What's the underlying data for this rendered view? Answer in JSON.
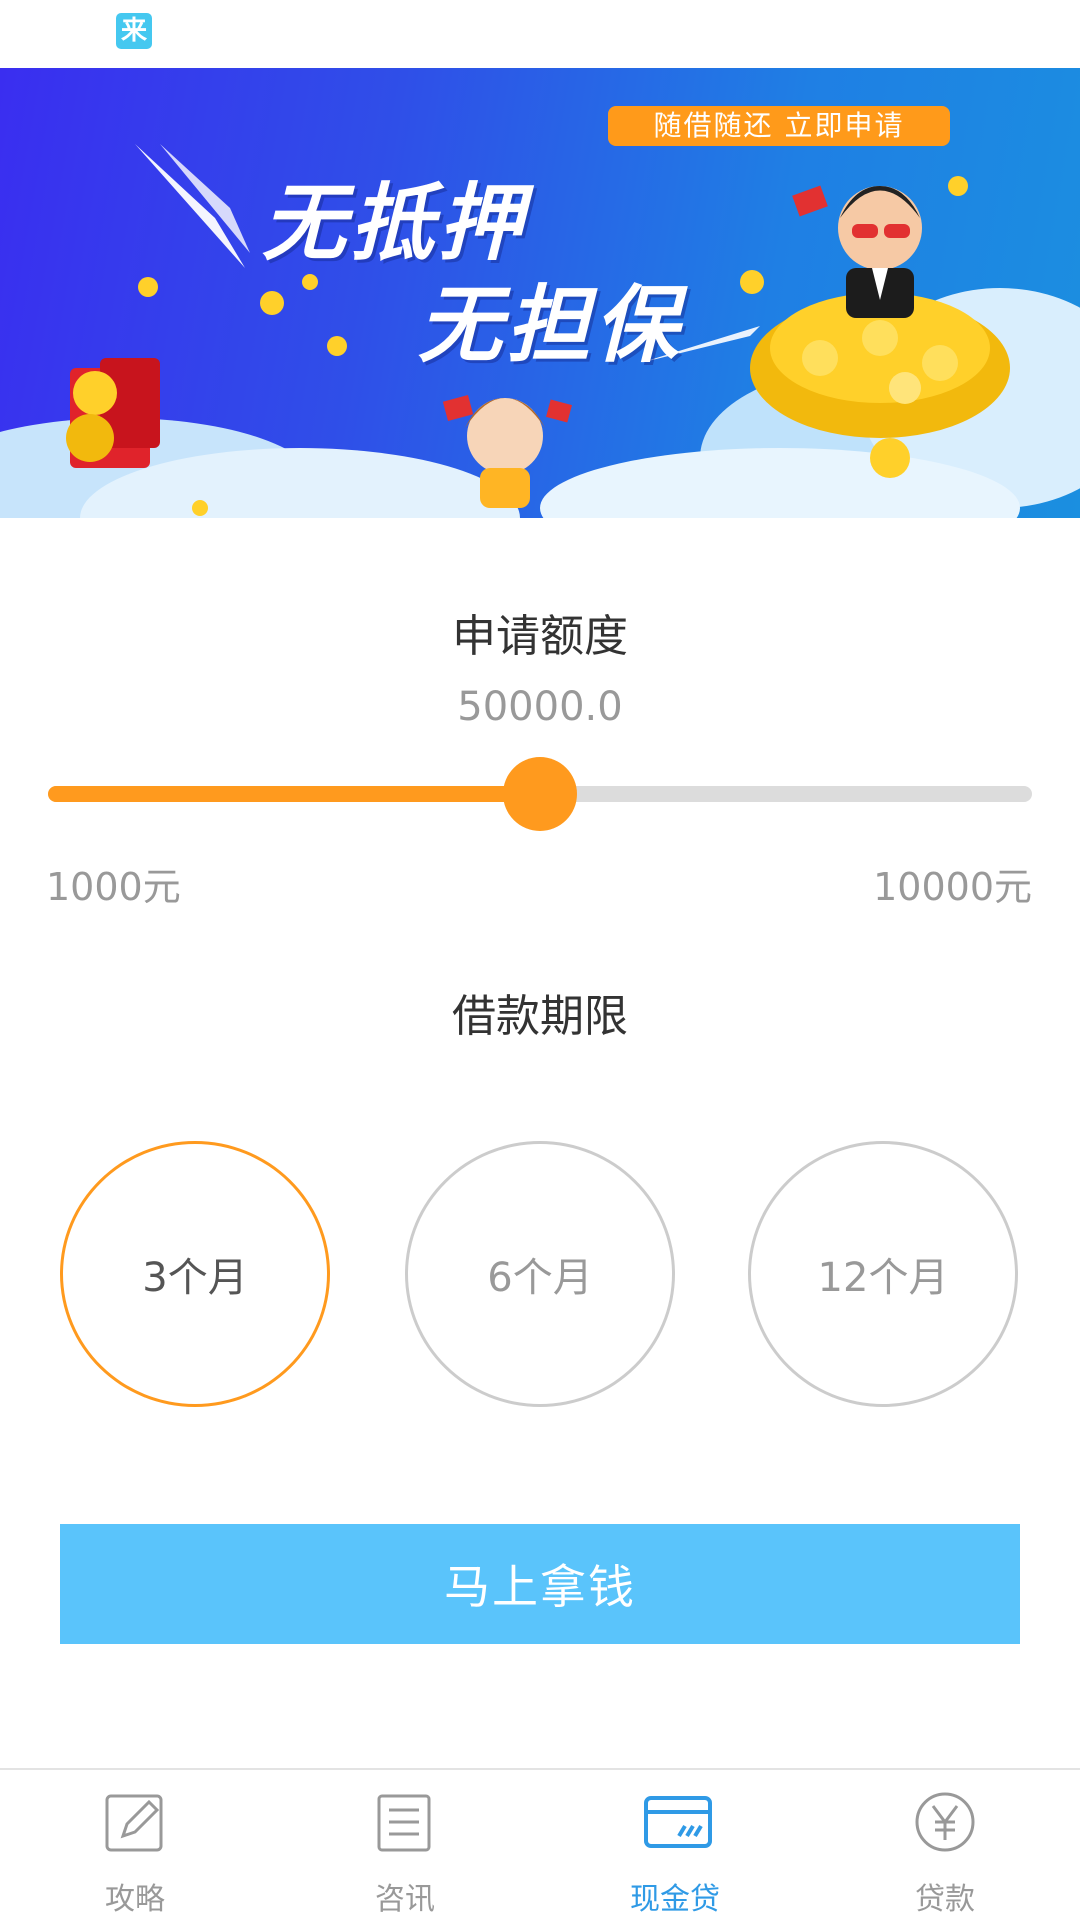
{
  "status_bar": {
    "app_badge": "来"
  },
  "banner": {
    "pill_text": "随借随还  立即申请",
    "headline_1": "无抵押",
    "headline_2": "无担保"
  },
  "amount_section": {
    "title": "申请额度",
    "value": "50000.0",
    "min_label": "1000元",
    "max_label": "10000元",
    "slider_fraction": 0.5
  },
  "term_section": {
    "title": "借款期限",
    "options": [
      "3个月",
      "6个月",
      "12个月"
    ],
    "selected_index": 0
  },
  "cta_label": "马上拿钱",
  "tabs": [
    {
      "label": "攻略",
      "icon": "edit-icon"
    },
    {
      "label": "咨讯",
      "icon": "news-icon"
    },
    {
      "label": "现金贷",
      "icon": "card-icon"
    },
    {
      "label": "贷款",
      "icon": "yen-circle-icon"
    }
  ],
  "active_tab_index": 2,
  "colors": {
    "accent": "#ff9a1e",
    "button": "#5ac4fb",
    "active_tab": "#2f9ae6",
    "inactive": "#999999"
  }
}
